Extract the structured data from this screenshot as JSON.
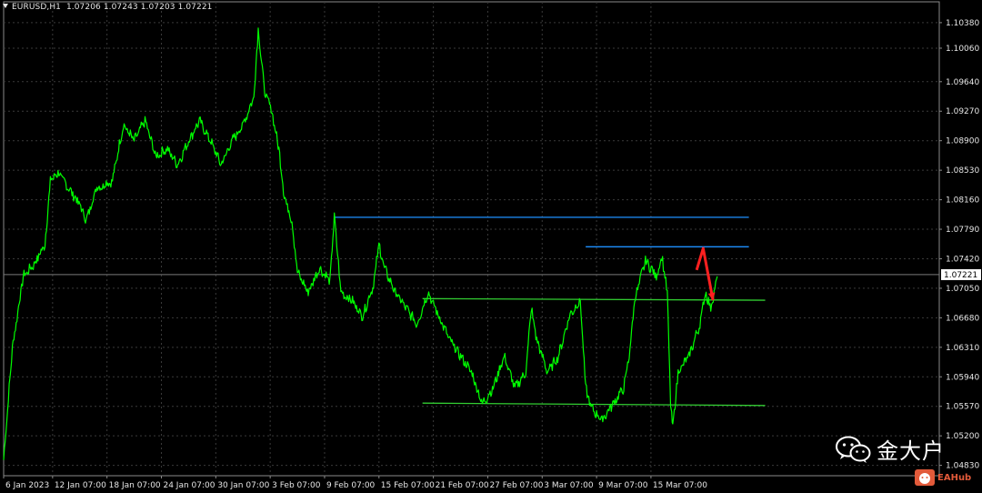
{
  "header": {
    "symbol": "EURUSD,H1",
    "ohlc": "1.07206 1.07243 1.07203 1.07221"
  },
  "watermark": {
    "text": "金大户",
    "icon": "wechat-icon"
  },
  "brand": {
    "text": "EAHub",
    "icon": "eahub-logo-icon"
  },
  "colors": {
    "background": "#000000",
    "price_line": "#00ff00",
    "grid": "#3a3a3a",
    "resistance_blue": "#1e90ff",
    "support_green": "#32cd32",
    "forecast_arrow": "#ff2020",
    "current_price_tag": "#ffffff"
  },
  "chart_data": {
    "type": "line",
    "title": "",
    "series": [
      {
        "values": [
          [
            1.049,
            0.0
          ],
          [
            1.063,
            0.8
          ],
          [
            1.072,
            1.8
          ],
          [
            1.0735,
            2.8
          ],
          [
            1.076,
            3.8
          ],
          [
            1.084,
            4.3
          ],
          [
            1.085,
            5.0
          ],
          [
            1.083,
            6.0
          ],
          [
            1.081,
            7.0
          ],
          [
            1.079,
            7.6
          ],
          [
            1.083,
            8.5
          ],
          [
            1.084,
            10.0
          ],
          [
            1.091,
            11.0
          ],
          [
            1.089,
            12.0
          ],
          [
            1.0915,
            13.0
          ],
          [
            1.087,
            14.0
          ],
          [
            1.088,
            15.0
          ],
          [
            1.086,
            16.0
          ],
          [
            1.089,
            17.0
          ],
          [
            1.0915,
            18.0
          ],
          [
            1.089,
            19.0
          ],
          [
            1.086,
            20.0
          ],
          [
            1.089,
            21.0
          ],
          [
            1.091,
            22.0
          ],
          [
            1.0945,
            23.0
          ],
          [
            1.103,
            23.4
          ],
          [
            1.095,
            24.0
          ],
          [
            1.093,
            24.6
          ],
          [
            1.088,
            25.3
          ],
          [
            1.082,
            25.8
          ],
          [
            1.079,
            26.5
          ],
          [
            1.0725,
            27.0
          ],
          [
            1.07,
            28.0
          ],
          [
            1.073,
            29.0
          ],
          [
            1.0715,
            30.0
          ],
          [
            1.0795,
            30.4
          ],
          [
            1.07,
            31.0
          ],
          [
            1.069,
            32.0
          ],
          [
            1.067,
            33.0
          ],
          [
            1.071,
            34.0
          ],
          [
            1.076,
            34.5
          ],
          [
            1.073,
            35.0
          ],
          [
            1.07,
            36.0
          ],
          [
            1.068,
            37.0
          ],
          [
            1.066,
            38.0
          ],
          [
            1.07,
            39.0
          ],
          [
            1.067,
            40.0
          ],
          [
            1.064,
            41.0
          ],
          [
            1.062,
            42.0
          ],
          [
            1.06,
            43.0
          ],
          [
            1.056,
            44.0
          ],
          [
            1.058,
            45.0
          ],
          [
            1.062,
            46.0
          ],
          [
            1.058,
            47.0
          ],
          [
            1.06,
            48.0
          ],
          [
            1.068,
            48.5
          ],
          [
            1.064,
            49.0
          ],
          [
            1.06,
            50.0
          ],
          [
            1.062,
            51.0
          ],
          [
            1.067,
            52.0
          ],
          [
            1.069,
            53.0
          ],
          [
            1.058,
            53.5
          ],
          [
            1.0555,
            54.0
          ],
          [
            1.054,
            55.0
          ],
          [
            1.056,
            56.0
          ],
          [
            1.058,
            57.0
          ],
          [
            1.062,
            57.5
          ],
          [
            1.069,
            58.0
          ],
          [
            1.074,
            59.0
          ],
          [
            1.072,
            60.0
          ],
          [
            1.0745,
            60.5
          ],
          [
            1.07,
            61.0
          ],
          [
            1.056,
            61.3
          ],
          [
            1.053,
            61.5
          ],
          [
            1.06,
            62.0
          ],
          [
            1.062,
            63.0
          ],
          [
            1.066,
            64.0
          ],
          [
            1.07,
            64.5
          ],
          [
            1.068,
            65.0
          ],
          [
            1.072,
            65.6
          ]
        ]
      }
    ],
    "yticks": [
      "1.10380",
      "1.10060",
      "1.09640",
      "1.09270",
      "1.08900",
      "1.08530",
      "1.08160",
      "1.07790",
      "1.07420",
      "1.07050",
      "1.06680",
      "1.06310",
      "1.05940",
      "1.05570",
      "1.05200",
      "1.04830"
    ],
    "ylim": [
      1.047,
      1.1055
    ],
    "current_price": "1.07221",
    "current_value": 1.07221,
    "xticks": [
      {
        "label": "6 Jan 2023",
        "x": 0
      },
      {
        "label": "12 Jan 07:00",
        "x": 4.5
      },
      {
        "label": "18 Jan 07:00",
        "x": 9.5
      },
      {
        "label": "24 Jan 07:00",
        "x": 14.5
      },
      {
        "label": "30 Jan 07:00",
        "x": 19.5
      },
      {
        "label": "3 Feb 07:00",
        "x": 24.5
      },
      {
        "label": "9 Feb 07:00",
        "x": 29.5
      },
      {
        "label": "15 Feb 07:00",
        "x": 34.5
      },
      {
        "label": "21 Feb 07:00",
        "x": 39.5
      },
      {
        "label": "27 Feb 07:00",
        "x": 44.5
      },
      {
        "label": "3 Mar 07:00",
        "x": 49.5
      },
      {
        "label": "9 Mar 07:00",
        "x": 54.5
      },
      {
        "label": "15 Mar 07:00",
        "x": 59.5
      }
    ],
    "xlim": [
      0,
      86
    ],
    "grid": true,
    "lines": [
      {
        "from": [
          30.4,
          1.0794
        ],
        "to": [
          68.5,
          1.0794
        ],
        "color": "resistance_blue"
      },
      {
        "from": [
          53.5,
          1.0757
        ],
        "to": [
          68.5,
          1.0757
        ],
        "color": "resistance_blue"
      },
      {
        "from": [
          38.5,
          1.0692
        ],
        "to": [
          70.0,
          1.069
        ],
        "color": "support_green"
      },
      {
        "from": [
          38.5,
          1.0561
        ],
        "to": [
          70.0,
          1.0558
        ],
        "color": "support_green"
      }
    ],
    "arrow": {
      "path": [
        [
          63.7,
          1.0728
        ],
        [
          64.3,
          1.0755
        ],
        [
          65.2,
          1.069
        ]
      ],
      "color": "forecast_arrow"
    }
  }
}
